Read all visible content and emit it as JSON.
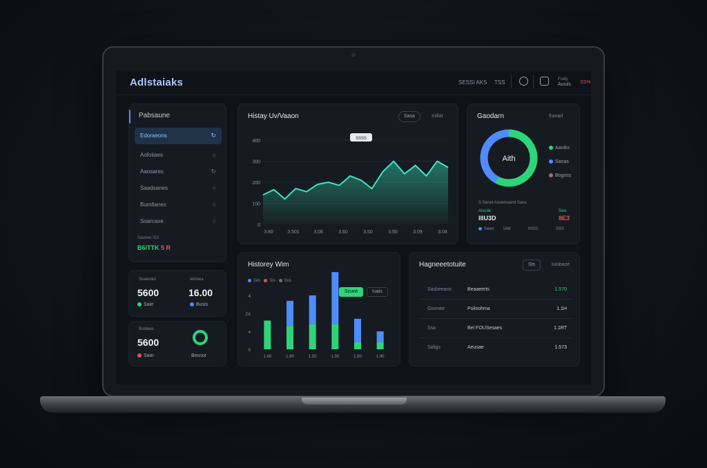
{
  "header": {
    "brand": "Adlstaiaks",
    "links": [
      "SESSI AKS",
      "TSS"
    ],
    "user_label": "Fcefy",
    "user_name": "Auiuls",
    "user_value": "SS%"
  },
  "sidebar": {
    "title": "Pabsaune",
    "items": [
      {
        "label": "Edoraeons",
        "active": true
      },
      {
        "label": "Aofoiiaes",
        "active": false
      },
      {
        "label": "Aaosares",
        "active": false
      },
      {
        "label": "Saadsanes",
        "active": false
      },
      {
        "label": "Bumfianes",
        "active": false
      },
      {
        "label": "Soarcaxe",
        "active": false
      }
    ],
    "stat_label": "Saurwe SiS",
    "stat_green": "B6/TTK ",
    "stat_red": "5 R"
  },
  "stats": {
    "card1": {
      "left_label": "Seaiunes",
      "left_value": "5600",
      "left_legend": "Saie",
      "right_label": "Ielonea",
      "right_value": "16.00",
      "right_legend": "Busis"
    },
    "card2": {
      "label": "Boldees",
      "value": "5600",
      "legend_left": "Saar",
      "legend_right": "Bousot"
    }
  },
  "line_panel": {
    "title": "Histay Uv/Vaaon",
    "pill": "Sasa",
    "link": "Inillat",
    "tooltip": "SSSS"
  },
  "donut_panel": {
    "title": "Gaodarn",
    "link": "Eanad",
    "center_label": "Aith",
    "legend": [
      "Aaniks",
      "Sanas",
      "Bogoss"
    ],
    "footer_label": "S Senet Aosemaenti Sans",
    "footer_left_value": "IIIU3D",
    "footer_right_value": "8E3",
    "footer_left_small": "Aiscde",
    "footer_right_small": "Seis",
    "footer_bottom": [
      "Seen",
      "IAM",
      "IHSS",
      "SSS"
    ]
  },
  "bar_panel": {
    "title": "Historey Wim",
    "legend": [
      "Ses",
      "Sis",
      "Sus"
    ],
    "btn_active": "Scuwt",
    "btn": "Iuais"
  },
  "table_panel": {
    "title": "Hagneeetotuite",
    "pill": "Sts",
    "link": "Iuisbaze",
    "rows": [
      {
        "c1": "Sasbeeans",
        "c2": "Beaaeerts",
        "c3": "1.570",
        "green": true
      },
      {
        "c1": "Goonee",
        "c2": "Pulisohma",
        "c3": "1.1H",
        "green": false
      },
      {
        "c1": "Ssa",
        "c2": "Bel FOUSesaes",
        "c3": "1.1RT",
        "green": false
      },
      {
        "c1": "Sallgs",
        "c2": "Aeusae",
        "c3": "1.573",
        "green": false
      }
    ]
  },
  "colors": {
    "accent_blue": "#4f8cff",
    "accent_green": "#2ed47a",
    "accent_teal": "#3ce6c4",
    "danger": "#e05252"
  },
  "chart_data": [
    {
      "type": "line",
      "title": "Histay Uv/Vaaon",
      "x": [
        "3.80",
        "3.501",
        "3.08",
        "3.60",
        "3.50",
        "3.50",
        "3.09",
        "3.08"
      ],
      "x_ticks": [
        "3.80",
        "3.501",
        "3.08",
        "3.60",
        "3.50",
        "3.50",
        "3.09",
        "3.08"
      ],
      "y_ticks": [
        "0",
        "100",
        "200",
        "300",
        "400"
      ],
      "ylim": [
        0,
        400
      ],
      "series": [
        {
          "values": [
            140,
            165,
            120,
            170,
            155,
            190,
            200,
            185,
            230,
            210,
            170,
            250,
            300,
            240,
            280,
            230,
            300,
            270
          ]
        }
      ]
    },
    {
      "type": "pie",
      "title": "Gaodarn",
      "labels": [
        "Aaniks",
        "Sanas"
      ],
      "values": [
        58,
        42
      ],
      "colors": [
        "#2ed47a",
        "#4f8cff"
      ]
    },
    {
      "type": "bar",
      "title": "Historey Wim",
      "categories": [
        "1.80",
        "1.90",
        "1.50",
        "1.90",
        "1.90",
        "1.90"
      ],
      "y_ticks": [
        "0",
        "4",
        "ZA",
        "4"
      ],
      "series": [
        {
          "values": [
            0,
            1.4,
            1.6,
            2.9,
            1.3,
            0.6
          ],
          "color": "#4f8cff"
        },
        {
          "values": [
            1.6,
            1.3,
            1.4,
            1.4,
            0.4,
            0.4
          ],
          "color": "#2ed47a"
        }
      ]
    }
  ]
}
